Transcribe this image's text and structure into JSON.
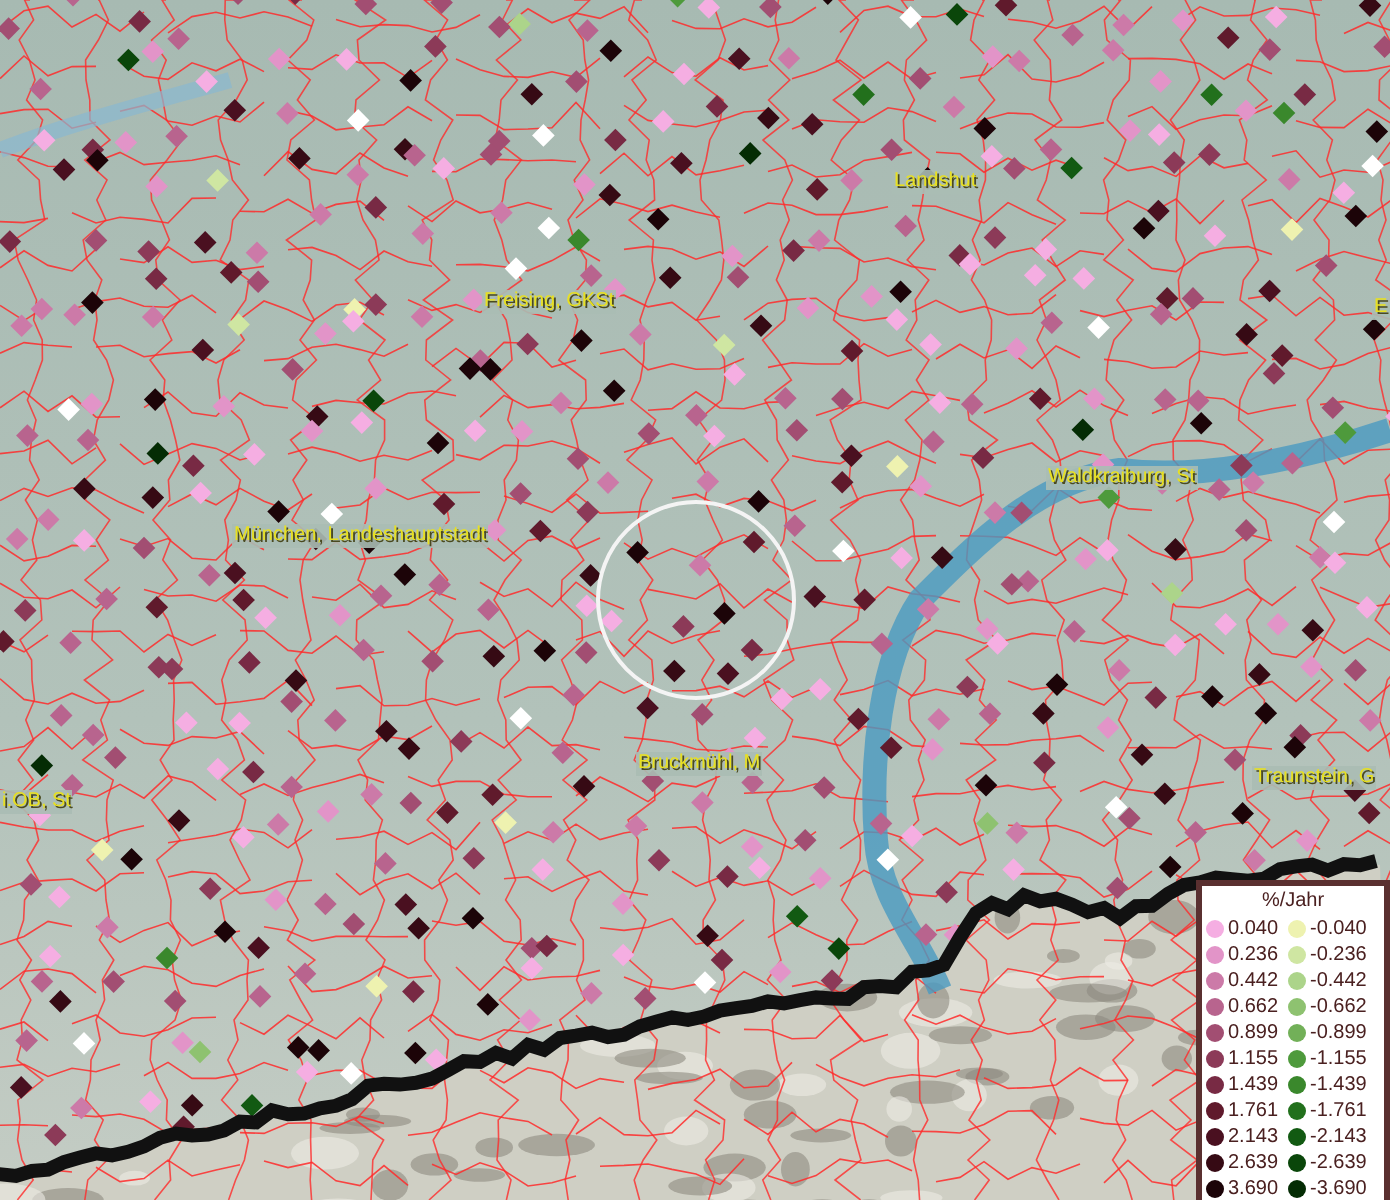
{
  "map": {
    "place_labels": [
      {
        "text": "Landshut"
      },
      {
        "text": "E"
      },
      {
        "text": "Freising, GKSt"
      },
      {
        "text": "Waldkraiburg, St"
      },
      {
        "text": "München, Landeshauptstadt"
      },
      {
        "text": "Bruckmühl, M"
      },
      {
        "text": "Traunstein, G"
      },
      {
        "text": "i.OB, St"
      }
    ]
  },
  "legend": {
    "title": "%/Jahr",
    "columns": [
      [
        {
          "label": "0.040",
          "color": "#f5aee2"
        },
        {
          "label": "0.236",
          "color": "#e294c8"
        },
        {
          "label": "0.442",
          "color": "#cc7aa8"
        },
        {
          "label": "0.662",
          "color": "#b8648e"
        },
        {
          "label": "0.899",
          "color": "#a24e72"
        },
        {
          "label": "1.155",
          "color": "#8c3a58"
        },
        {
          "label": "1.439",
          "color": "#782a44"
        },
        {
          "label": "1.761",
          "color": "#601a2c"
        },
        {
          "label": "2.143",
          "color": "#4a1020"
        },
        {
          "label": "2.639",
          "color": "#360a14"
        },
        {
          "label": "3.690",
          "color": "#1c0408"
        }
      ],
      [
        {
          "label": "-0.040",
          "color": "#eef2b0"
        },
        {
          "label": "-0.236",
          "color": "#cfe6a2"
        },
        {
          "label": "-0.442",
          "color": "#acd48a"
        },
        {
          "label": "-0.662",
          "color": "#8ec270"
        },
        {
          "label": "-0.899",
          "color": "#72b058"
        },
        {
          "label": "-1.155",
          "color": "#4e9a3c"
        },
        {
          "label": "-1.439",
          "color": "#3a882c"
        },
        {
          "label": "-1.761",
          "color": "#22701c"
        },
        {
          "label": "-2.143",
          "color": "#125a12"
        },
        {
          "label": "-2.639",
          "color": "#0a460a"
        },
        {
          "label": "-3.690",
          "color": "#042c04"
        }
      ]
    ]
  }
}
